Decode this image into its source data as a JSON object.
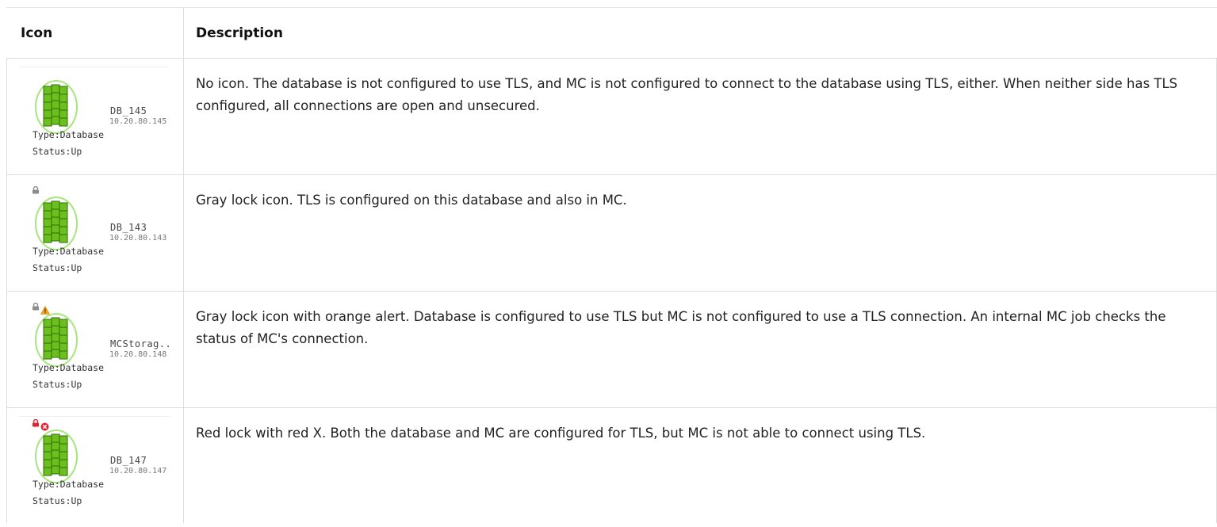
{
  "headers": {
    "icon": "Icon",
    "description": "Description"
  },
  "rows": [
    {
      "name": "DB_145",
      "ip": "10.20.80.145",
      "type": "Type:Database",
      "status": "Status:Up",
      "lock": "none",
      "badge": "none",
      "description": "No icon. The database is not configured to use TLS, and MC is not configured to connect to the database using TLS, either. When neither side has TLS configured, all connections are open and unsecured."
    },
    {
      "name": "DB_143",
      "ip": "10.20.80.143",
      "type": "Type:Database",
      "status": "Status:Up",
      "lock": "gray-lock-icon",
      "badge": "none",
      "description": "Gray lock icon. TLS is configured on this database and also in MC."
    },
    {
      "name": "MCStorag..",
      "ip": "10.20.80.148",
      "type": "Type:Database",
      "status": "Status:Up",
      "lock": "gray-lock-icon",
      "badge": "orange-alert-icon",
      "description": "Gray lock icon with orange alert. Database is configured to use TLS but MC is not configured to use a TLS connection. An internal MC job checks the status of MC's connection."
    },
    {
      "name": "DB_147",
      "ip": "10.20.80.147",
      "type": "Type:Database",
      "status": "Status:Up",
      "lock": "red-lock-icon",
      "badge": "red-x-icon",
      "description": "Red lock with red X. Both the database and MC are configured for TLS, but MC is not able to connect using TLS."
    }
  ],
  "colors": {
    "db_green": "#6cc01e",
    "db_dark_green": "#2f6b0a",
    "ring_green": "#9be36a",
    "lock_gray": "#8c8c8c",
    "lock_red": "#e0242e",
    "alert_orange": "#f4a81d"
  }
}
